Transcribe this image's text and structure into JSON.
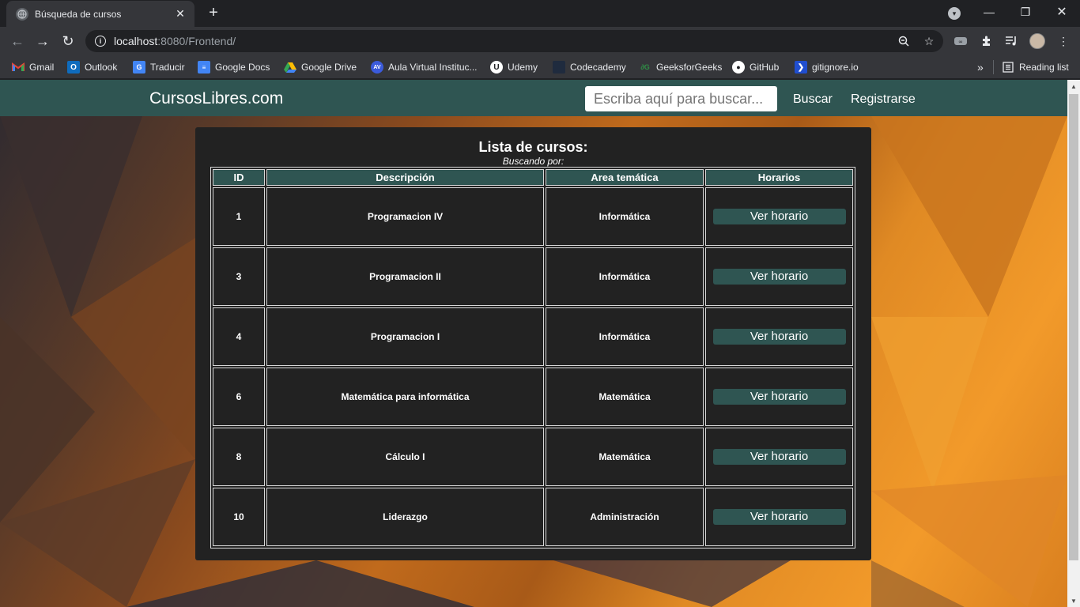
{
  "browser": {
    "tab_title": "Búsqueda de cursos",
    "url_host": "localhost",
    "url_rest": ":8080/Frontend/",
    "bookmarks": [
      {
        "label": "Gmail",
        "icon": "gmail-icon"
      },
      {
        "label": "Outlook",
        "icon": "outlook-icon"
      },
      {
        "label": "Traducir",
        "icon": "translate-icon"
      },
      {
        "label": "Google Docs",
        "icon": "docs-icon"
      },
      {
        "label": "Google Drive",
        "icon": "drive-icon"
      },
      {
        "label": "Aula Virtual Instituc...",
        "icon": "aula-icon"
      },
      {
        "label": "Udemy",
        "icon": "udemy-icon"
      },
      {
        "label": "Codecademy",
        "icon": "codecademy-icon"
      },
      {
        "label": "GeeksforGeeks",
        "icon": "geeksforgeeks-icon"
      },
      {
        "label": "GitHub",
        "icon": "github-icon"
      },
      {
        "label": "gitignore.io",
        "icon": "gitignore-icon"
      }
    ],
    "more_bookmarks": "»",
    "reading_list": "Reading list"
  },
  "site": {
    "brand": "CursosLibres.com",
    "search_placeholder": "Escriba aquí para buscar...",
    "search_button": "Buscar",
    "register_link": "Registrarse"
  },
  "panel": {
    "title": "Lista de cursos:",
    "subtitle": "Buscando por:",
    "columns": [
      "ID",
      "Descripción",
      "Area temática",
      "Horarios"
    ],
    "rows": [
      {
        "id": "1",
        "descripcion": "Programacion IV",
        "area": "Informática",
        "action": "Ver horario"
      },
      {
        "id": "3",
        "descripcion": "Programacion II",
        "area": "Informática",
        "action": "Ver horario"
      },
      {
        "id": "4",
        "descripcion": "Programacion I",
        "area": "Informática",
        "action": "Ver horario"
      },
      {
        "id": "6",
        "descripcion": "Matemática para informática",
        "area": "Matemática",
        "action": "Ver horario"
      },
      {
        "id": "8",
        "descripcion": "Cálculo I",
        "area": "Matemática",
        "action": "Ver horario"
      },
      {
        "id": "10",
        "descripcion": "Liderazgo",
        "area": "Administración",
        "action": "Ver horario"
      }
    ]
  },
  "colors": {
    "navbar": "#2f5552",
    "panel": "#222222",
    "accent": "#2f5552"
  }
}
